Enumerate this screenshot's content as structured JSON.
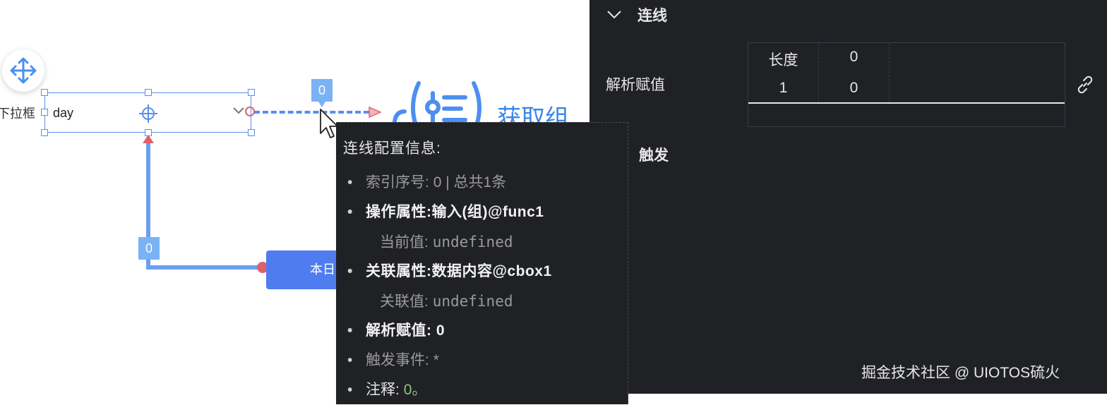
{
  "canvas": {
    "left_label": "下拉框",
    "input_value": "day",
    "badge_top": "0",
    "badge_mid": "0",
    "button_label": "本日",
    "func_label": "获取组"
  },
  "tooltip": {
    "title": "连线配置信息:",
    "index_label": "索引序号:",
    "index_value": "0 | 总共1条",
    "op_prop_label": "操作属性:",
    "op_prop_value": "输入(组)@func1",
    "current_label": "当前值:",
    "current_value": "undefined",
    "rel_prop_label": "关联属性:",
    "rel_prop_value": "数据内容@cbox1",
    "rel_value_label": "关联值:",
    "rel_value_value": "undefined",
    "parse_label": "解析赋值:",
    "parse_value": "0",
    "trigger_label": "触发事件:",
    "trigger_value": "*",
    "note_label": "注释:",
    "note_value": "0。"
  },
  "panel": {
    "section_title": "连线",
    "parse_label": "解析赋值",
    "grid": {
      "header": [
        "长度",
        "0"
      ],
      "row": [
        "1",
        "0"
      ]
    },
    "trigger_section": "触发",
    "watermark": "掘金技术社区 @ UIOTOS硫火"
  },
  "icons": [
    "move-icon",
    "crosshair-icon",
    "chevron-down-icon",
    "arrow-right-icon",
    "function-icon",
    "mouse-pointer-icon",
    "link-icon"
  ],
  "colors": {
    "accent_blue": "#5b8df0",
    "badge_blue": "#7ab2f6",
    "button_blue": "#4f7df0",
    "link_red": "#e0606a",
    "func_blue": "#3a86e8",
    "panel_bg": "#202125",
    "note_green": "#8cc57a"
  }
}
